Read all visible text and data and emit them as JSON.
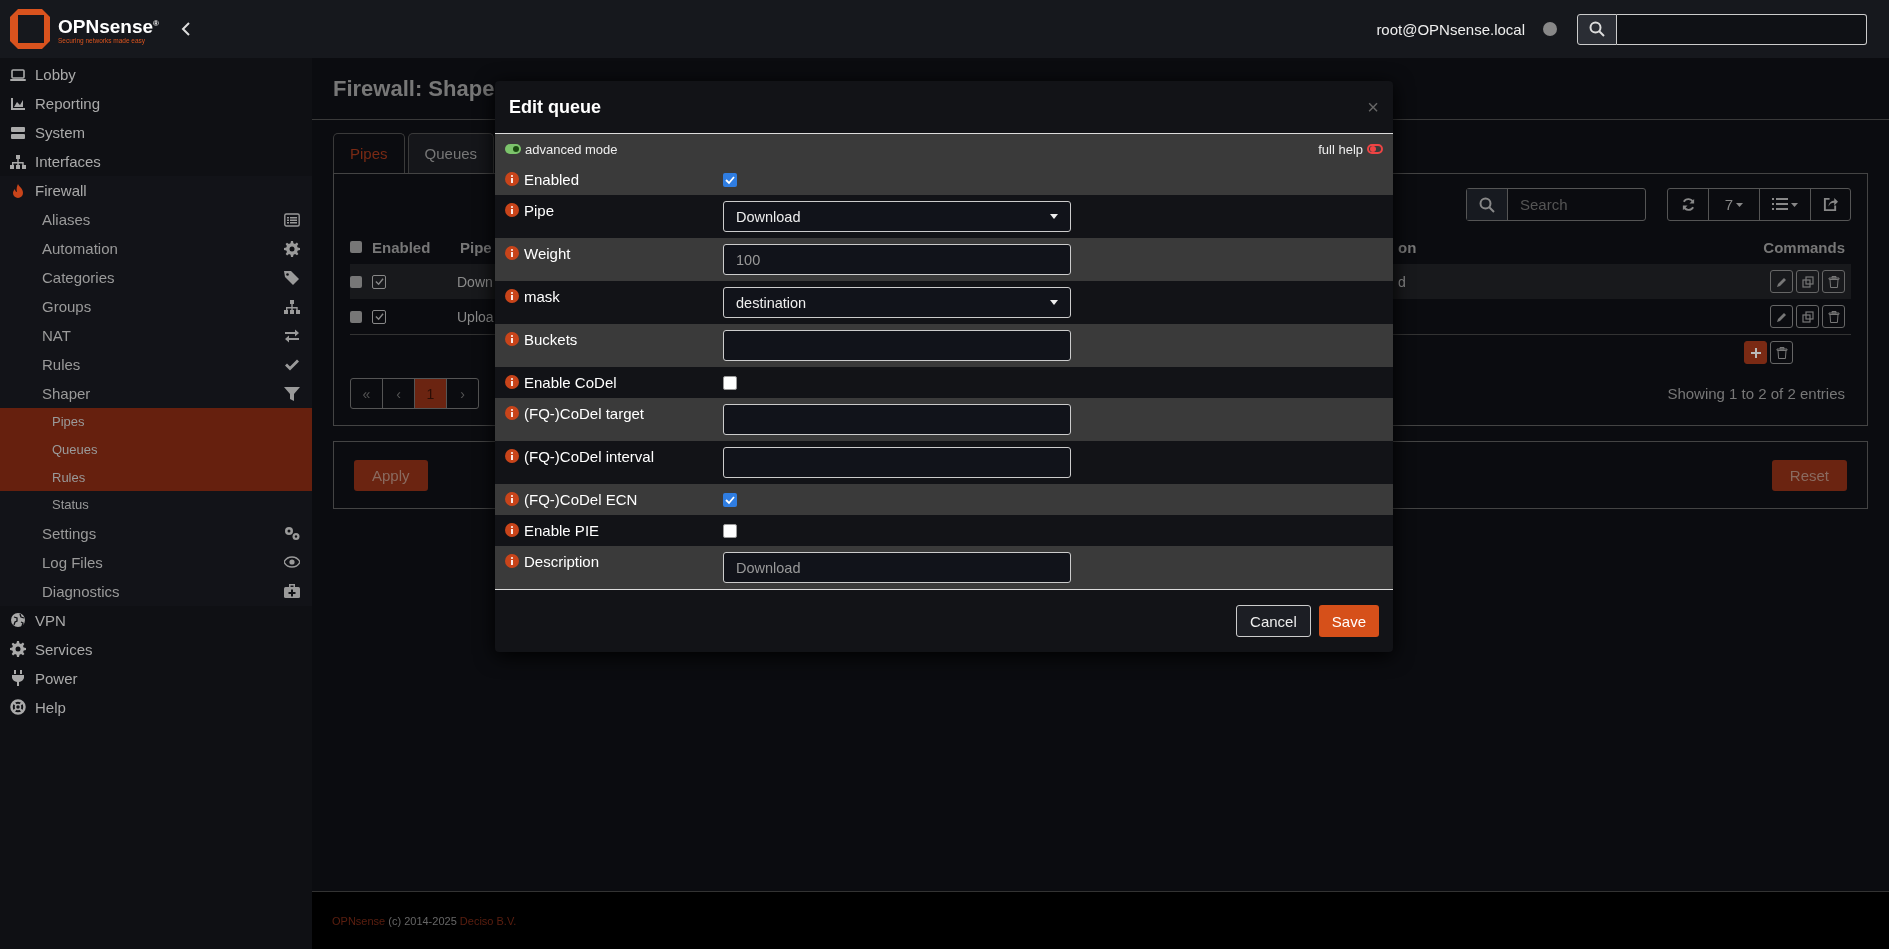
{
  "header": {
    "brand": "OPNsense",
    "brand_mark": "®",
    "tagline": "Securing networks made easy",
    "user": "root@OPNsense.local"
  },
  "sidebar": {
    "items": [
      {
        "label": "Lobby",
        "active": false
      },
      {
        "label": "Reporting",
        "active": false
      },
      {
        "label": "System",
        "active": false
      },
      {
        "label": "Interfaces",
        "active": false
      },
      {
        "label": "Firewall",
        "active": true,
        "children": [
          {
            "label": "Aliases"
          },
          {
            "label": "Automation"
          },
          {
            "label": "Categories"
          },
          {
            "label": "Groups"
          },
          {
            "label": "NAT"
          },
          {
            "label": "Rules"
          },
          {
            "label": "Shaper",
            "children": [
              {
                "label": "Pipes",
                "selected": true
              },
              {
                "label": "Queues",
                "selected": true
              },
              {
                "label": "Rules",
                "selected": true
              },
              {
                "label": "Status",
                "selected": false
              }
            ]
          },
          {
            "label": "Settings"
          },
          {
            "label": "Log Files"
          },
          {
            "label": "Diagnostics"
          }
        ]
      },
      {
        "label": "VPN",
        "active": false
      },
      {
        "label": "Services",
        "active": false
      },
      {
        "label": "Power",
        "active": false
      },
      {
        "label": "Help",
        "active": false
      }
    ]
  },
  "page": {
    "title": "Firewall: Shape",
    "tabs": [
      {
        "label": "Pipes",
        "selected": true
      },
      {
        "label": "Queues",
        "selected": false
      }
    ],
    "search": {
      "placeholder": "Search"
    },
    "page_size": "7",
    "table": {
      "all_selected": false,
      "columns": [
        "Enabled",
        "Pipe",
        "on",
        "Commands"
      ],
      "rows": [
        {
          "selected": false,
          "enabled": true,
          "pipe": "Down",
          "column_3": "d"
        },
        {
          "selected": false,
          "enabled": true,
          "pipe": "Uploa"
        }
      ]
    },
    "pagination": [
      {
        "label": "«",
        "selected": false
      },
      {
        "label": "‹",
        "selected": false
      },
      {
        "label": "1",
        "selected": true
      },
      {
        "label": "›",
        "selected": false
      }
    ],
    "entries_info": "Showing 1 to 2 of 2 entries",
    "apply": "Apply",
    "reset": "Reset"
  },
  "modal": {
    "title": "Edit queue",
    "close": "×",
    "advanced_mode": {
      "label": "advanced mode",
      "on": true
    },
    "full_help": {
      "label": "full help",
      "on": false
    },
    "fields": [
      {
        "kind": "checkbox",
        "label": "Enabled",
        "checked": true
      },
      {
        "kind": "select",
        "label": "Pipe",
        "value": "Download"
      },
      {
        "kind": "text",
        "label": "Weight",
        "placeholder": "100"
      },
      {
        "kind": "select",
        "label": "mask",
        "value": "destination"
      },
      {
        "kind": "text",
        "label": "Buckets"
      },
      {
        "kind": "checkbox",
        "label": "Enable CoDel",
        "checked": false
      },
      {
        "kind": "text",
        "label": "(FQ-)CoDel target"
      },
      {
        "kind": "text",
        "label": "(FQ-)CoDel interval"
      },
      {
        "kind": "checkbox",
        "label": "(FQ-)CoDel ECN",
        "checked": true
      },
      {
        "kind": "checkbox",
        "label": "Enable PIE",
        "checked": false
      },
      {
        "kind": "text",
        "label": "Description",
        "placeholder": "Download"
      }
    ],
    "buttons": [
      {
        "label": "Cancel",
        "kind": "secondary"
      },
      {
        "label": "Save",
        "kind": "primary"
      }
    ]
  },
  "footer": {
    "brand": "OPNsense",
    "copyright": "(c) 2014-2025",
    "company": "Deciso B.V."
  }
}
